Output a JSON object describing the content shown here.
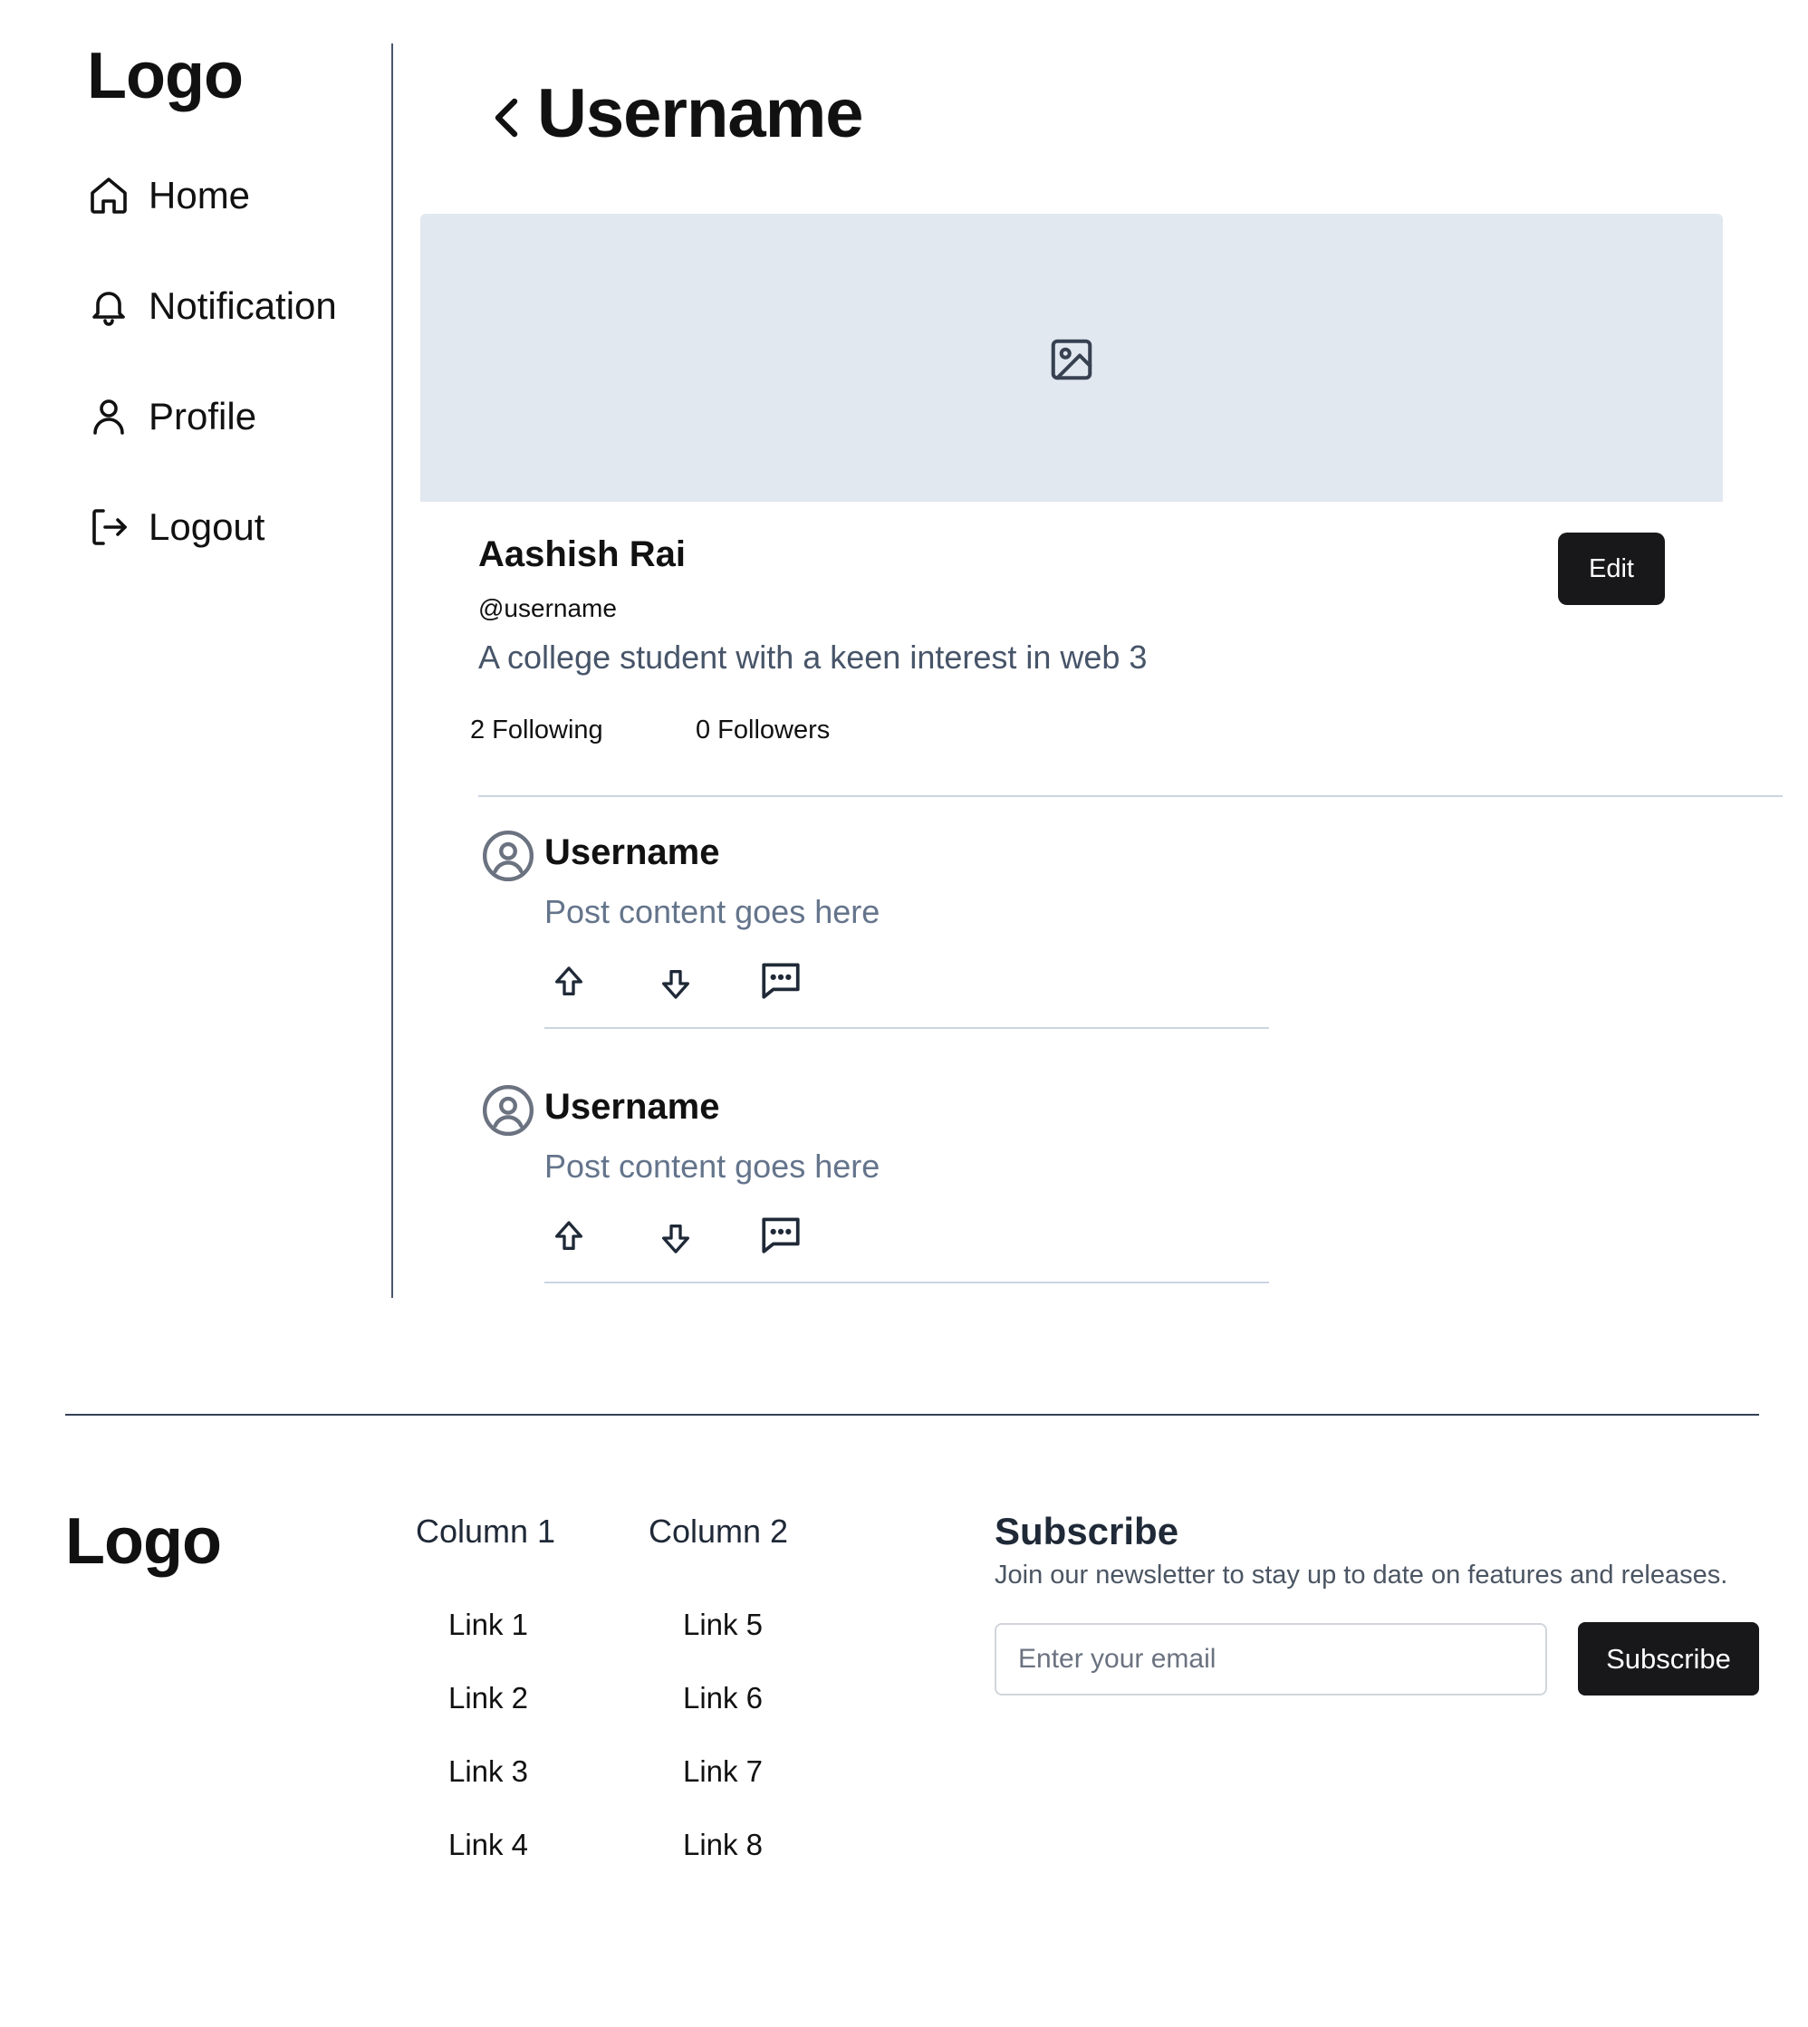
{
  "sidebar": {
    "logo": "Logo",
    "nav": [
      {
        "label": "Home",
        "icon": "home-icon"
      },
      {
        "label": "Notification",
        "icon": "bell-icon"
      },
      {
        "label": "Profile",
        "icon": "user-icon"
      },
      {
        "label": "Logout",
        "icon": "logout-icon"
      }
    ]
  },
  "header": {
    "title": "Username",
    "back_icon": "chevron-left-icon"
  },
  "banner": {
    "icon": "image-icon",
    "color": "#e2e8f0"
  },
  "profile": {
    "name": "Aashish Rai",
    "handle": "@username",
    "bio": "A college student with a keen interest in web 3",
    "following": "2 Following",
    "followers": "0 Followers",
    "edit_label": "Edit"
  },
  "posts": [
    {
      "username": "Username",
      "content": "Post content goes here"
    },
    {
      "username": "Username",
      "content": "Post content goes here"
    }
  ],
  "post_actions": {
    "upvote_icon": "arrow-up-icon",
    "downvote_icon": "arrow-down-icon",
    "comment_icon": "comment-icon"
  },
  "footer": {
    "logo": "Logo",
    "columns": [
      {
        "title": "Column 1",
        "links": [
          "Link 1",
          "Link 2",
          "Link 3",
          "Link 4"
        ]
      },
      {
        "title": "Column 2",
        "links": [
          "Link 5",
          "Link 6",
          "Link 7",
          "Link 8"
        ]
      }
    ],
    "subscribe": {
      "title": "Subscribe",
      "description": "Join our newsletter to stay up to date on features and releases.",
      "placeholder": "Enter your email",
      "button": "Subscribe"
    }
  },
  "colors": {
    "accent_dark": "#18181b",
    "muted_text": "#64748b",
    "divider": "#cbd5e1"
  }
}
